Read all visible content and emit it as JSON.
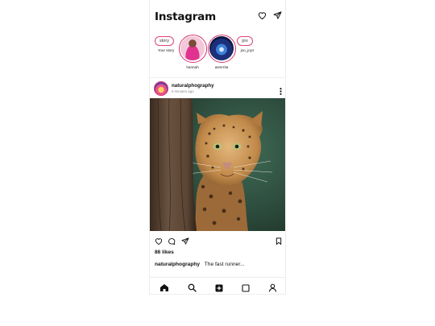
{
  "app": {
    "title": "Instagram"
  },
  "stories": [
    {
      "ring_text": "story",
      "name": "Your story"
    },
    {
      "name": "hannah"
    },
    {
      "name": "asmrrita"
    },
    {
      "ring_text": "joo",
      "name": "joo_joyz"
    }
  ],
  "post": {
    "user": "naturalphography",
    "time": "6 minutes ago",
    "likes": "86 likes",
    "caption_user": "naturalphography",
    "caption_text": "The fast runner..."
  },
  "icons": {
    "top": [
      "heart-icon",
      "send-icon"
    ],
    "post_actions": [
      "heart-icon",
      "comment-icon",
      "send-icon",
      "bookmark-icon"
    ],
    "nav": [
      "home-icon",
      "search-icon",
      "add-post-icon",
      "reels-icon",
      "profile-icon"
    ]
  },
  "colors": {
    "story_ring": "#d6336c",
    "text": "#111111"
  }
}
